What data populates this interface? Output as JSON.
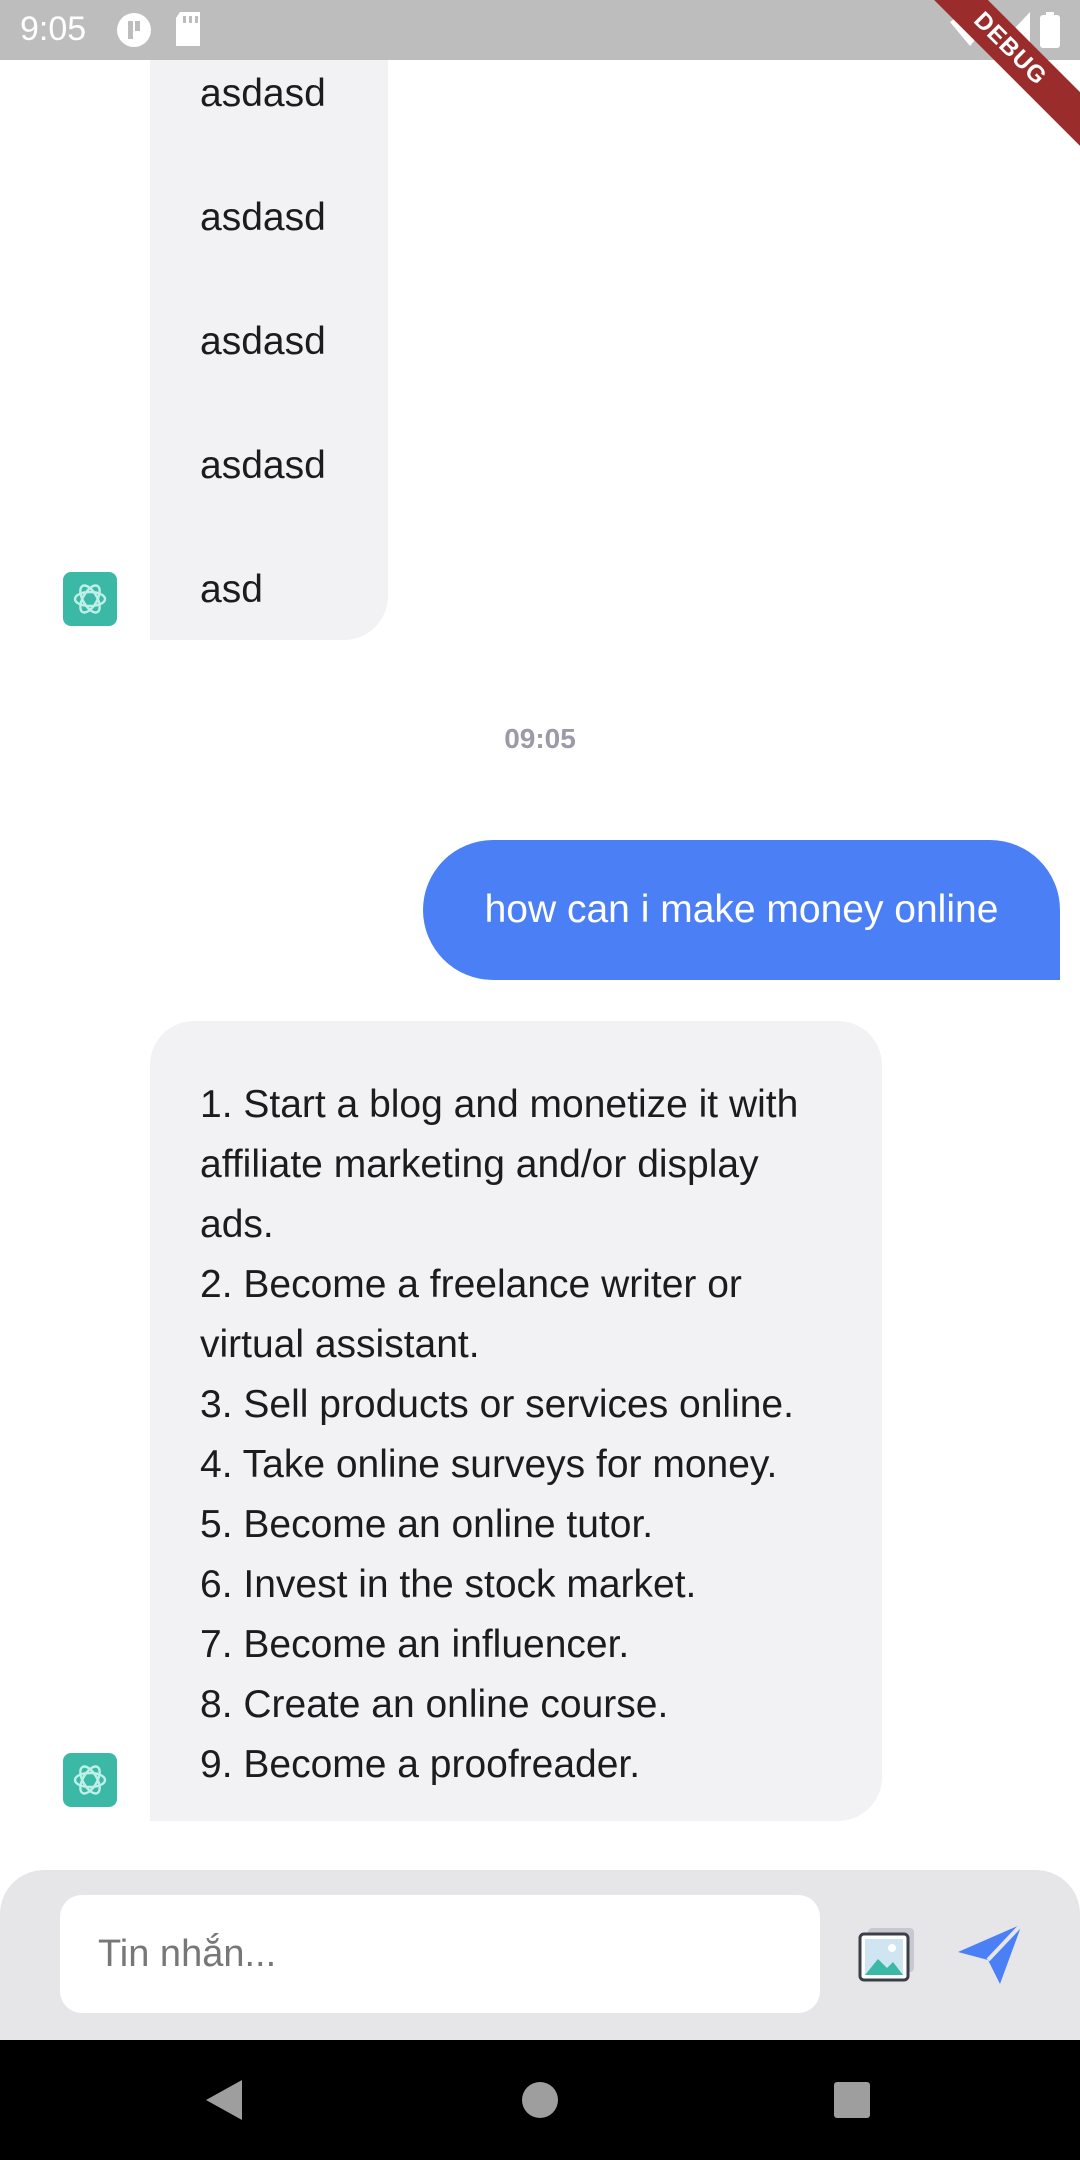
{
  "status_bar": {
    "time": "9:05",
    "debug_label": "DEBUG"
  },
  "chat": {
    "previous_bot_message": {
      "lines": [
        "asdasd",
        "asdasd",
        "asdasd",
        "asdasd",
        "asd"
      ]
    },
    "timestamp": "09:05",
    "user_message": "how can i make money online",
    "bot_reply": {
      "lines": [
        "1. Start a blog and monetize it with",
        "affiliate marketing and/or display",
        "ads.",
        "2. Become a freelance writer or",
        "virtual assistant.",
        "3. Sell products or services online.",
        "4. Take online surveys for money.",
        "5. Become an online tutor.",
        "6. Invest in the stock market.",
        "7. Become an influencer.",
        "8. Create an online course.",
        "9. Become a proofreader."
      ]
    }
  },
  "composer": {
    "placeholder": "Tin nhắn...",
    "value": ""
  },
  "icons": {
    "avatar": "openai-logo-icon",
    "image": "image-picker-icon",
    "send": "send-icon",
    "back": "nav-back-icon",
    "home": "nav-home-icon",
    "recents": "nav-recents-icon"
  },
  "colors": {
    "accent": "#4b7ff6",
    "bot_bubble": "#f2f2f5",
    "avatar": "#3cb8a6",
    "composer_bg": "#e6e6e9"
  }
}
